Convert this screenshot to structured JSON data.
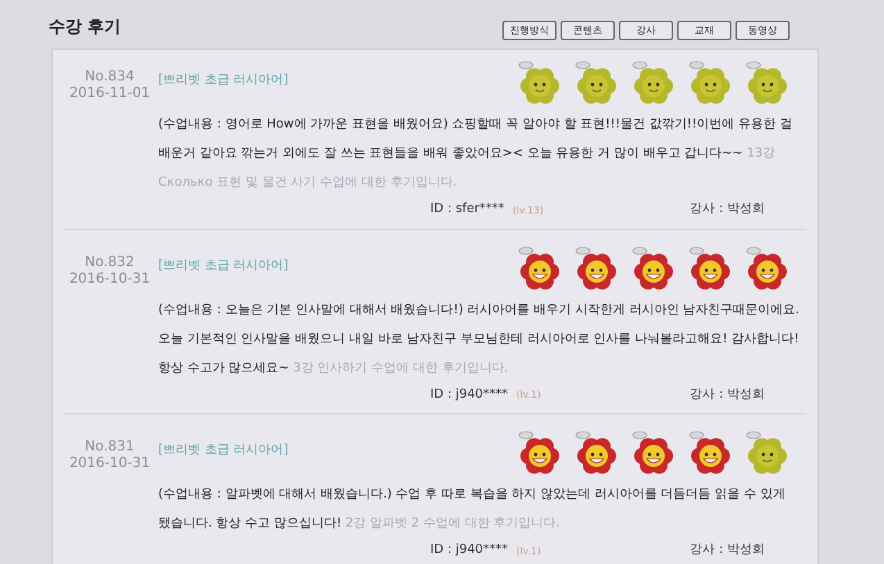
{
  "title": "수강 후기",
  "filters": [
    {
      "label": "진행방식"
    },
    {
      "label": "콘텐츠"
    },
    {
      "label": "강사"
    },
    {
      "label": "교재"
    },
    {
      "label": "동영상"
    }
  ],
  "reviews": [
    {
      "number": "No.834",
      "date": "2016-11-01",
      "course": "[쁘리벳 초급 러시아어]",
      "flowers": [
        {
          "kind": "plain"
        },
        {
          "kind": "plain"
        },
        {
          "kind": "plain"
        },
        {
          "kind": "plain"
        },
        {
          "kind": "plain"
        }
      ],
      "text": "(수업내용 : 영어로 How에 가까운 표현을 배웠어요) 쇼핑할때 꼭 알아야 할 표현!!!물건 값깎기!!이번에 유용한 걸 배운거 같아요 깎는거 외에도 잘 쓰는 표현들을 배워 좋았어요>< 오늘 유용한 거 많이 배우고 갑니다~~",
      "note": "13강 Сколько 표현 및 물건 사기 수업에 대한 후기입니다.",
      "id": "ID : sfer****",
      "level": "(lv.13)",
      "teacher": "강사 : 박성희"
    },
    {
      "number": "No.832",
      "date": "2016-10-31",
      "course": "[쁘리벳 초급 러시아어]",
      "flowers": [
        {
          "kind": "happy"
        },
        {
          "kind": "happy"
        },
        {
          "kind": "happy"
        },
        {
          "kind": "happy"
        },
        {
          "kind": "happy"
        }
      ],
      "text": "(수업내용 : 오늘은 기본 인사말에 대해서 배웠습니다!) 러시아어를 배우기 시작한게 러시아인 남자친구때문이에요. 오늘 기본적인 인사말을 배웠으니 내일 바로 남자친구 부모님한테 러시아어로 인사를 나눠볼라고해요! 감사합니다! 항상 수고가 많으세요~",
      "note": "3강 인사하기 수업에 대한 후기입니다.",
      "id": "ID : j940****",
      "level": "(lv.1)",
      "teacher": "강사 : 박성희"
    },
    {
      "number": "No.831",
      "date": "2016-10-31",
      "course": "[쁘리벳 초급 러시아어]",
      "flowers": [
        {
          "kind": "happy"
        },
        {
          "kind": "happy"
        },
        {
          "kind": "happy"
        },
        {
          "kind": "happy"
        },
        {
          "kind": "plain"
        }
      ],
      "text": "(수업내용 : 알파벳에 대해서 배웠습니다.) 수업 후 따로 복습을 하지 않았는데 러시아어를 더듬더듬 읽을 수 있게 됐습니다. 항상 수고 많으십니다!",
      "note": "2강 알파벳 2 수업에 대한 후기입니다.",
      "id": "ID : j940****",
      "level": "(lv.1)",
      "teacher": "강사 : 박성희"
    }
  ]
}
